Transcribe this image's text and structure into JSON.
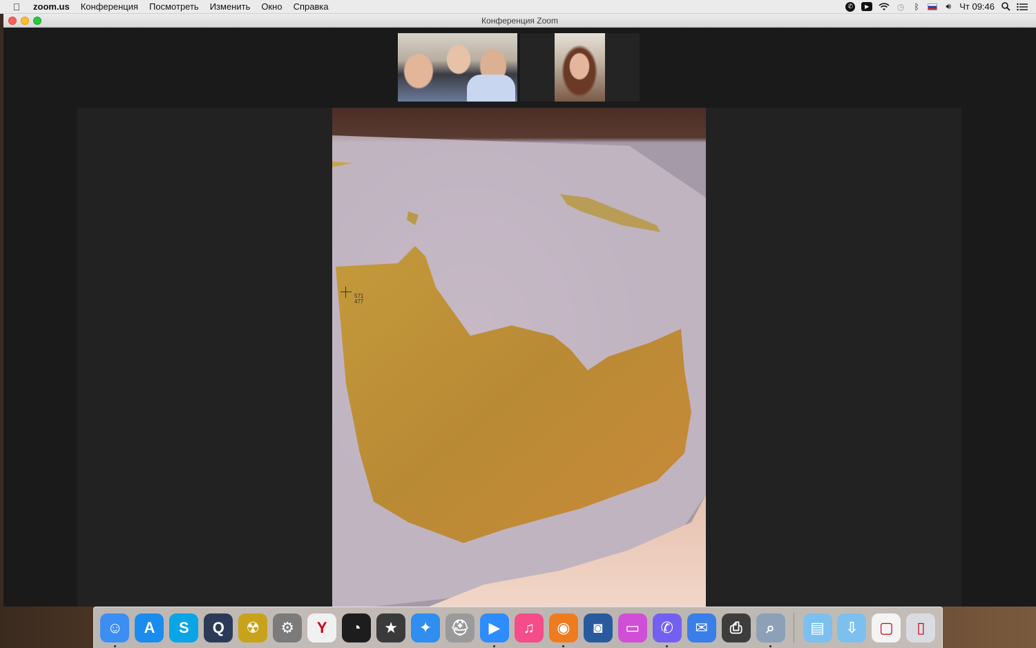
{
  "menubar": {
    "app_name": "zoom.us",
    "menus": [
      "Конференция",
      "Посмотреть",
      "Изменить",
      "Окно",
      "Справка"
    ],
    "clock": "Чт 09:46",
    "status_icons": [
      "viber-icon",
      "zoom-icon",
      "wifi-icon",
      "time-machine-icon",
      "bluetooth-icon",
      "flag-ru-icon",
      "volume-icon",
      "spotlight-icon",
      "notification-center-icon"
    ]
  },
  "window": {
    "title": "Конференция Zoom"
  },
  "video": {
    "cursor_x": "571",
    "cursor_y": "477"
  },
  "dock": {
    "apps": [
      {
        "name": "finder-icon",
        "glyph": "☺",
        "bg": "#3c8ef3",
        "running": true
      },
      {
        "name": "app-store-icon",
        "glyph": "A",
        "bg": "#1a8cf0",
        "running": false
      },
      {
        "name": "skype-icon",
        "glyph": "S",
        "bg": "#0aa5e6",
        "running": false
      },
      {
        "name": "quicktime-icon",
        "glyph": "Q",
        "bg": "#2b3a57",
        "running": false
      },
      {
        "name": "radiation-app-icon",
        "glyph": "☢",
        "bg": "#c8a21a",
        "running": false
      },
      {
        "name": "system-preferences-icon",
        "glyph": "⚙",
        "bg": "#7b7b7b",
        "running": false
      },
      {
        "name": "yandex-browser-icon",
        "glyph": "Y",
        "bg": "#f1f1f1",
        "running": false
      },
      {
        "name": "dashboard-icon",
        "glyph": "◔",
        "bg": "#1d1d1d",
        "running": false
      },
      {
        "name": "imovie-icon",
        "glyph": "★",
        "bg": "#3a3a3a",
        "running": false
      },
      {
        "name": "safari-icon",
        "glyph": "✦",
        "bg": "#2f8ef0",
        "running": false
      },
      {
        "name": "disk-utility-icon",
        "glyph": "⛑",
        "bg": "#9a9a9a",
        "running": false
      },
      {
        "name": "zoom-icon",
        "glyph": "▶",
        "bg": "#2d8cff",
        "running": true
      },
      {
        "name": "itunes-icon",
        "glyph": "♫",
        "bg": "#f54c8a",
        "running": false
      },
      {
        "name": "firefox-icon",
        "glyph": "◉",
        "bg": "#ef7b1f",
        "running": true
      },
      {
        "name": "camera-icon",
        "glyph": "◙",
        "bg": "#2a5a9e",
        "running": false
      },
      {
        "name": "imac-icon",
        "glyph": "▭",
        "bg": "#d04fd6",
        "running": false
      },
      {
        "name": "viber-icon",
        "glyph": "✆",
        "bg": "#7360f2",
        "running": true
      },
      {
        "name": "mail-icon",
        "glyph": "✉",
        "bg": "#3a7ee8",
        "running": false
      },
      {
        "name": "printer-icon",
        "glyph": "⎙",
        "bg": "#3d3d3d",
        "running": false
      },
      {
        "name": "preview-icon",
        "glyph": "⌕",
        "bg": "#8ca0b8",
        "running": true
      }
    ],
    "folders": [
      {
        "name": "documents-folder-icon",
        "glyph": "▤",
        "bg": "#7cc0ef"
      },
      {
        "name": "downloads-folder-icon",
        "glyph": "⇩",
        "bg": "#7cc0ef"
      },
      {
        "name": "firefox-download-icon",
        "glyph": "▢",
        "bg": "#f4f4f4"
      },
      {
        "name": "trash-icon",
        "glyph": "▯",
        "bg": "#d9dde2"
      }
    ]
  }
}
